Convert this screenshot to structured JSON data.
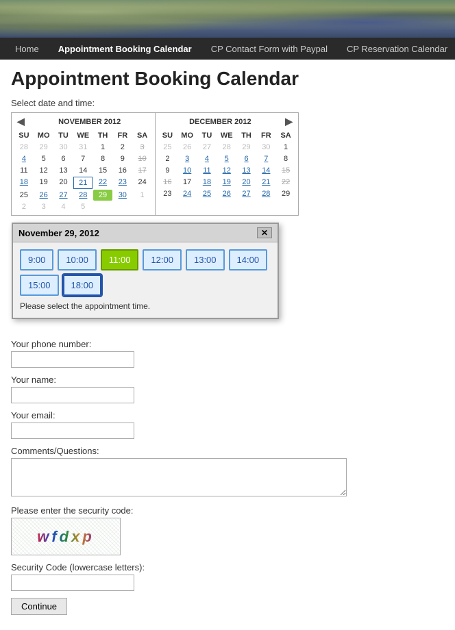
{
  "header": {
    "alt": "Rocky coastline header image"
  },
  "nav": {
    "items": [
      {
        "id": "home",
        "label": "Home",
        "active": false
      },
      {
        "id": "appointment",
        "label": "Appointment Booking Calendar",
        "active": true
      },
      {
        "id": "contact",
        "label": "CP Contact Form with Paypal",
        "active": false
      },
      {
        "id": "reservation",
        "label": "CP Reservation Calendar",
        "active": false
      }
    ]
  },
  "page": {
    "title": "Appointment Booking Calendar",
    "select_label": "Select date and time:"
  },
  "november": {
    "title": "NOVEMBER 2012",
    "headers": [
      "SU",
      "MO",
      "TU",
      "WE",
      "TH",
      "FR",
      "SA"
    ],
    "rows": [
      [
        {
          "val": "28",
          "type": "other-month"
        },
        {
          "val": "29",
          "type": "other-month"
        },
        {
          "val": "30",
          "type": "other-month"
        },
        {
          "val": "31",
          "type": "other-month"
        },
        {
          "val": "1",
          "type": "current-month"
        },
        {
          "val": "2",
          "type": "current-month"
        },
        {
          "val": "3",
          "type": "strikethrough"
        }
      ],
      [
        {
          "val": "4",
          "type": "link"
        },
        {
          "val": "5",
          "type": "current-month"
        },
        {
          "val": "6",
          "type": "current-month"
        },
        {
          "val": "7",
          "type": "current-month"
        },
        {
          "val": "8",
          "type": "current-month"
        },
        {
          "val": "9",
          "type": "current-month"
        },
        {
          "val": "10",
          "type": "strikethrough"
        }
      ],
      [
        {
          "val": "11",
          "type": "current-month"
        },
        {
          "val": "12",
          "type": "current-month"
        },
        {
          "val": "13",
          "type": "current-month"
        },
        {
          "val": "14",
          "type": "current-month"
        },
        {
          "val": "15",
          "type": "current-month"
        },
        {
          "val": "16",
          "type": "current-month"
        },
        {
          "val": "17",
          "type": "strikethrough"
        }
      ],
      [
        {
          "val": "18",
          "type": "link"
        },
        {
          "val": "19",
          "type": "current-month"
        },
        {
          "val": "20",
          "type": "current-month"
        },
        {
          "val": "21",
          "type": "today-hl"
        },
        {
          "val": "22",
          "type": "link"
        },
        {
          "val": "23",
          "type": "link"
        },
        {
          "val": "24",
          "type": "current-month"
        }
      ],
      [
        {
          "val": "25",
          "type": "current-month"
        },
        {
          "val": "26",
          "type": "link"
        },
        {
          "val": "27",
          "type": "link"
        },
        {
          "val": "28",
          "type": "link"
        },
        {
          "val": "29",
          "type": "green-hl"
        },
        {
          "val": "30",
          "type": "link"
        },
        {
          "val": "1",
          "type": "other-month"
        }
      ],
      [
        {
          "val": "2",
          "type": "other-month"
        },
        {
          "val": "3",
          "type": "other-month"
        },
        {
          "val": "4",
          "type": "other-month"
        },
        {
          "val": "5",
          "type": "other-month"
        },
        {
          "val": "",
          "type": "empty"
        },
        {
          "val": "",
          "type": "empty"
        },
        {
          "val": "",
          "type": "empty"
        }
      ]
    ]
  },
  "december": {
    "title": "DECEMBER 2012",
    "headers": [
      "SU",
      "MO",
      "TU",
      "WE",
      "TH",
      "FR",
      "SA"
    ],
    "rows": [
      [
        {
          "val": "25",
          "type": "other-month"
        },
        {
          "val": "26",
          "type": "other-month"
        },
        {
          "val": "27",
          "type": "other-month"
        },
        {
          "val": "28",
          "type": "other-month"
        },
        {
          "val": "29",
          "type": "other-month"
        },
        {
          "val": "30",
          "type": "other-month"
        },
        {
          "val": "1",
          "type": "current-month"
        }
      ],
      [
        {
          "val": "2",
          "type": "current-month"
        },
        {
          "val": "3",
          "type": "link"
        },
        {
          "val": "4",
          "type": "link"
        },
        {
          "val": "5",
          "type": "link"
        },
        {
          "val": "6",
          "type": "link"
        },
        {
          "val": "7",
          "type": "link"
        },
        {
          "val": "8",
          "type": "current-month"
        }
      ],
      [
        {
          "val": "9",
          "type": "current-month"
        },
        {
          "val": "10",
          "type": "link"
        },
        {
          "val": "11",
          "type": "link"
        },
        {
          "val": "12",
          "type": "link"
        },
        {
          "val": "13",
          "type": "link"
        },
        {
          "val": "14",
          "type": "link"
        },
        {
          "val": "15",
          "type": "strikethrough"
        }
      ],
      [
        {
          "val": "16",
          "type": "strikethrough"
        },
        {
          "val": "17",
          "type": "current-month"
        },
        {
          "val": "18",
          "type": "link"
        },
        {
          "val": "19",
          "type": "link"
        },
        {
          "val": "20",
          "type": "link"
        },
        {
          "val": "21",
          "type": "link"
        },
        {
          "val": "22",
          "type": "strikethrough"
        }
      ],
      [
        {
          "val": "23",
          "type": "current-month"
        },
        {
          "val": "24",
          "type": "link"
        },
        {
          "val": "25",
          "type": "link"
        },
        {
          "val": "26",
          "type": "link"
        },
        {
          "val": "27",
          "type": "link"
        },
        {
          "val": "28",
          "type": "link"
        },
        {
          "val": "29",
          "type": "current-month"
        }
      ]
    ]
  },
  "time_popup": {
    "title": "November 29, 2012",
    "close_label": "✕",
    "slots": [
      {
        "time": "9:00",
        "selected": false
      },
      {
        "time": "10:00",
        "selected": false
      },
      {
        "time": "11:00",
        "selected": true
      },
      {
        "time": "12:00",
        "selected": false
      },
      {
        "time": "13:00",
        "selected": false
      },
      {
        "time": "14:00",
        "selected": false
      },
      {
        "time": "15:00",
        "selected": false
      },
      {
        "time": "18:00",
        "selected": false,
        "outlined": true
      }
    ],
    "note": "Please select the appointment time."
  },
  "form": {
    "phone_label": "Your phone number:",
    "phone_placeholder": "",
    "name_label": "Your name:",
    "name_placeholder": "",
    "email_label": "Your email:",
    "email_placeholder": "",
    "comments_label": "Comments/Questions:",
    "comments_placeholder": "",
    "security_label": "Please enter the security code:",
    "security_code_display": "wfdxp",
    "security_input_label": "Security Code (lowercase letters):",
    "security_placeholder": "",
    "continue_label": "Continue"
  }
}
